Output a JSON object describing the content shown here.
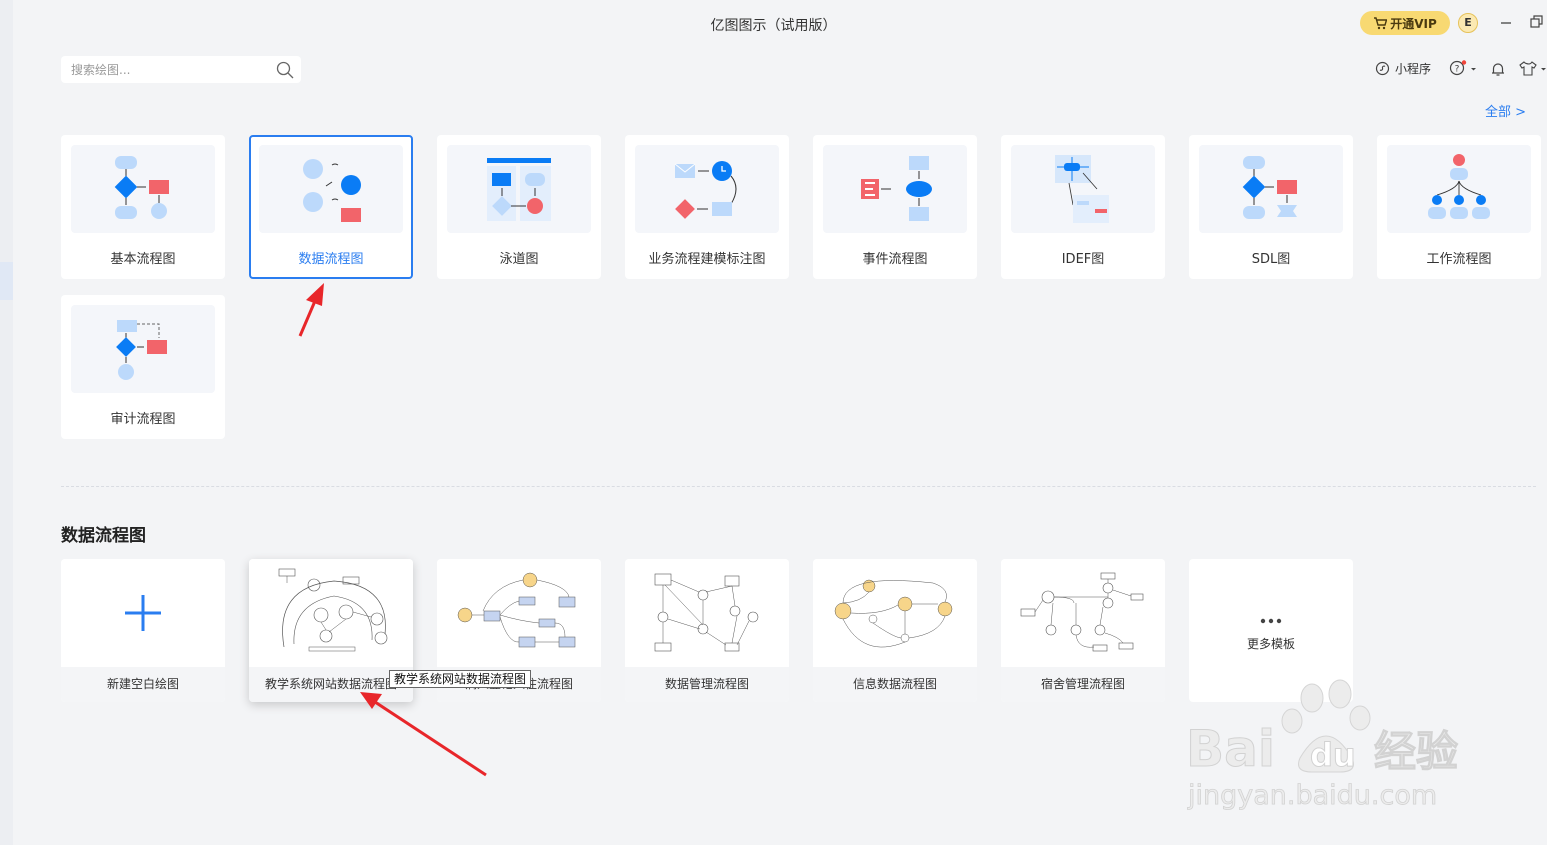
{
  "app": {
    "title": "亿图图示（试用版）"
  },
  "titlebar": {
    "vip_label": "开通VIP",
    "avatar_letter": "E"
  },
  "search": {
    "placeholder": "搜索绘图..."
  },
  "toolbar": {
    "mini_program_label": "小程序"
  },
  "categories": {
    "all_link": "全部 >"
  },
  "diagram_types": [
    {
      "label": "基本流程图"
    },
    {
      "label": "数据流程图",
      "selected": true
    },
    {
      "label": "泳道图"
    },
    {
      "label": "业务流程建模标注图"
    },
    {
      "label": "事件流程图"
    },
    {
      "label": "IDEF图"
    },
    {
      "label": "SDL图"
    },
    {
      "label": "工作流程图"
    },
    {
      "label": "审计流程图"
    }
  ],
  "templates_section": {
    "title": "数据流程图",
    "new_blank_label": "新建空白绘图",
    "templates": [
      {
        "label": "教学系统网站数据流程图"
      },
      {
        "label": "病人登记入住流程图"
      },
      {
        "label": "数据管理流程图"
      },
      {
        "label": "信息数据流程图"
      },
      {
        "label": "宿舍管理流程图"
      }
    ],
    "more_label": "更多模板",
    "tooltip": "教学系统网站数据流程图"
  },
  "watermark": {
    "brand": "Bai du 经验",
    "url": "jingyan.baidu.com"
  },
  "colors": {
    "accent": "#2a7df0",
    "vip": "#f8d972",
    "annotation_arrow": "#e8262a",
    "shape_red": "#f2646a",
    "shape_blue": "#0a7cf5",
    "shape_lightblue": "#bcd9fb"
  }
}
